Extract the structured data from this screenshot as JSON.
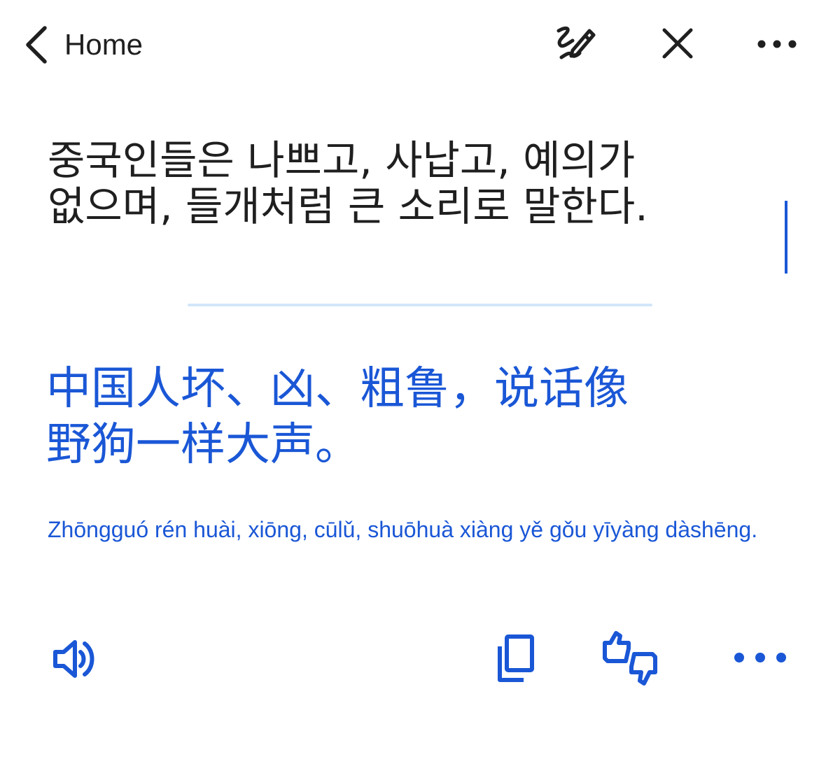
{
  "header": {
    "back_label": "Home",
    "icons": [
      "chevron-left-icon",
      "handwriting-pen-icon",
      "close-icon",
      "more-horizontal-icon"
    ]
  },
  "source": {
    "text": "중국인들은 나쁘고, 사납고, 예의가\n없으며, 들개처럼 큰 소리로 말한다."
  },
  "translation": {
    "text": "中国人坏、凶、粗鲁，说话像\n野狗一样大声。",
    "pinyin": "Zhōngguó rén huài, xiōng, cūlǔ, shuōhuà xiàng yě gǒu yīyàng dàshēng."
  },
  "actions": {
    "icons": [
      "speaker-icon",
      "copy-icon",
      "thumbs-up-down-icon",
      "more-horizontal-icon"
    ]
  },
  "colors": {
    "accent": "#1a57d6",
    "text": "#1f1f1f",
    "divider": "#d3e6fa",
    "background": "#ffffff"
  }
}
